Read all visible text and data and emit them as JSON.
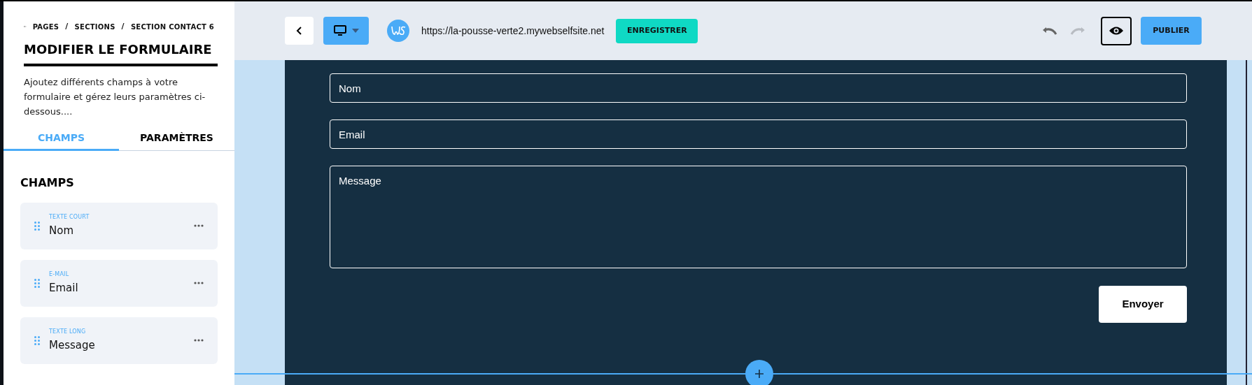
{
  "sidebar": {
    "breadcrumb": [
      {
        "kind": "link",
        "text": "PAGES"
      },
      {
        "kind": "separator",
        "text": "/"
      },
      {
        "kind": "link",
        "text": "SECTIONS"
      },
      {
        "kind": "separator",
        "text": "/"
      },
      {
        "kind": "link",
        "text": "SECTION CONTACT 6"
      }
    ],
    "title": "MODIFIER LE FORMULAIRE",
    "description": "Ajoutez différents champs à votre formulaire et gérez leurs paramètres ci-dessous....",
    "tabs": [
      {
        "label": "CHAMPS",
        "selected": true
      },
      {
        "label": "PARAMÈTRES",
        "selected": false
      }
    ],
    "section_title": "CHAMPS",
    "fields": [
      {
        "type": "TEXTE COURT",
        "name": "Nom"
      },
      {
        "type": "E-MAIL",
        "name": "Email"
      },
      {
        "type": "TEXTE LONG",
        "name": "Message"
      }
    ]
  },
  "toolbar": {
    "url": "https://la-pousse-verte2.mywebselfsite.net",
    "save": "ENREGISTRER",
    "undo": {
      "disabled": false
    },
    "redo": {
      "disabled": true
    },
    "publish": "PUBLIER"
  },
  "form": {
    "fields": [
      {
        "kind": "input",
        "placeholder": "Nom"
      },
      {
        "kind": "input",
        "placeholder": "Email"
      },
      {
        "kind": "textarea",
        "placeholder": "Message"
      }
    ],
    "submit": "Envoyer"
  }
}
